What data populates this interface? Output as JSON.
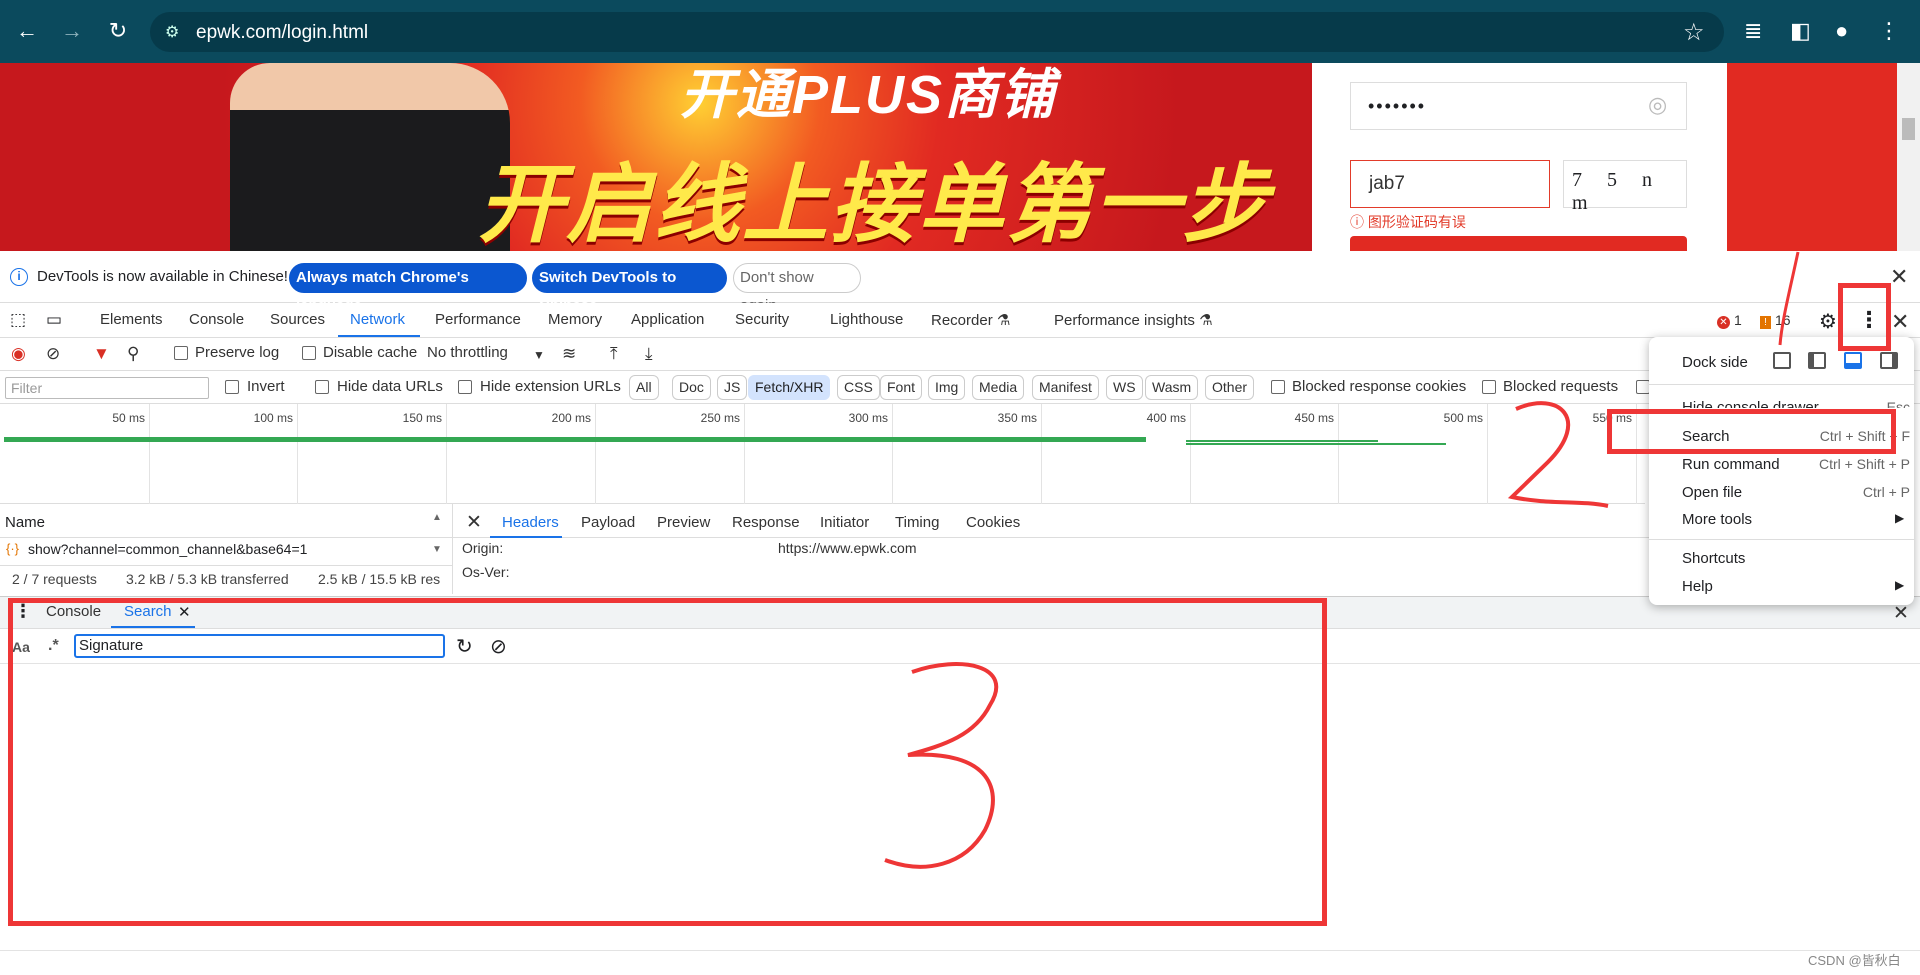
{
  "browser": {
    "url": "epwk.com/login.html",
    "back_icon": "arrow-left-icon",
    "forward_icon": "arrow-right-icon",
    "reload_icon": "reload-icon"
  },
  "page": {
    "banner_line1": "开通PLUS商铺",
    "banner_line2": "开启线上接单第一步",
    "password_value": "•••••••",
    "captcha_value": "jab7",
    "captcha_image_text": "7 5 n m",
    "captcha_error": "图形验证码有误"
  },
  "infobar": {
    "message": "DevTools is now available in Chinese!",
    "btn_match": "Always match Chrome's language",
    "btn_switch": "Switch DevTools to Chinese",
    "btn_dont_show": "Don't show again"
  },
  "tabs": [
    "Elements",
    "Console",
    "Sources",
    "Network",
    "Performance",
    "Memory",
    "Application",
    "Security",
    "Lighthouse",
    "Recorder",
    "Performance insights"
  ],
  "badges": {
    "errors": "1",
    "warnings": "16"
  },
  "toolbar": {
    "preserve_log": "Preserve log",
    "disable_cache": "Disable cache",
    "throttling": "No throttling"
  },
  "filter": {
    "placeholder": "Filter",
    "invert": "Invert",
    "hide_data_urls": "Hide data URLs",
    "hide_extension_urls": "Hide extension URLs",
    "types": [
      "All",
      "Doc",
      "JS",
      "Fetch/XHR",
      "CSS",
      "Font",
      "Img",
      "Media",
      "Manifest",
      "WS",
      "Wasm",
      "Other"
    ],
    "selected_type": "Fetch/XHR",
    "blocked_cookies": "Blocked response cookies",
    "blocked_requests": "Blocked requests"
  },
  "timeline": {
    "ticks": [
      "50 ms",
      "100 ms",
      "150 ms",
      "200 ms",
      "250 ms",
      "300 ms",
      "350 ms",
      "400 ms",
      "450 ms",
      "500 ms",
      "550 ms"
    ]
  },
  "requests": {
    "name_header": "Name",
    "rows": [
      "show?channel=common_channel&base64=1"
    ],
    "status_requests": "2 / 7 requests",
    "status_transferred": "3.2 kB / 5.3 kB transferred",
    "status_resources": "2.5 kB / 15.5 kB res"
  },
  "details": {
    "tabs": [
      "Headers",
      "Payload",
      "Preview",
      "Response",
      "Initiator",
      "Timing",
      "Cookies"
    ],
    "headers": [
      {
        "key": "Origin:",
        "value": "https://www.epwk.com"
      },
      {
        "key": "Os-Ver:",
        "value": ""
      }
    ]
  },
  "drawer": {
    "tabs": [
      "Console",
      "Search"
    ],
    "case_toggle": "Aa",
    "regex_toggle": ".*",
    "search_value": "Signature"
  },
  "menu": {
    "dock_side": "Dock side",
    "hide_drawer": "Hide console drawer",
    "hide_drawer_sc": "Esc",
    "items": [
      {
        "label": "Search",
        "shortcut": "Ctrl + Shift + F"
      },
      {
        "label": "Run command",
        "shortcut": "Ctrl + Shift + P"
      },
      {
        "label": "Open file",
        "shortcut": "Ctrl + P"
      },
      {
        "label": "More tools",
        "shortcut": ""
      }
    ],
    "shortcuts": "Shortcuts",
    "help": "Help"
  },
  "watermark": "CSDN @皆秋白",
  "colors": {
    "annotation": "#ee3636",
    "accent": "#1a73e8",
    "browser_bar": "#0b4a5d"
  }
}
